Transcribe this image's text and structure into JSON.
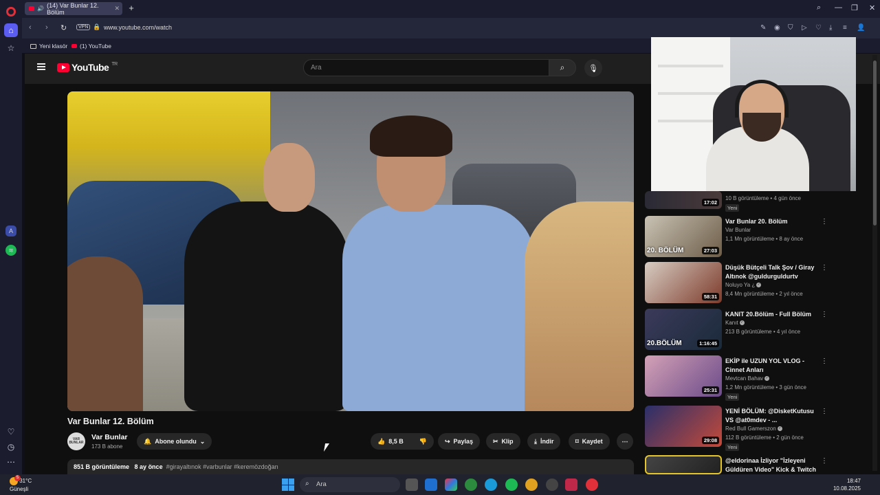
{
  "browser": {
    "tab_title": "(14) Var Bunlar 12. Bölüm",
    "url": "www.youtube.com/watch",
    "vpn_label": "VPN",
    "bookmarks": [
      "Yeni klasör",
      "(1) YouTube"
    ]
  },
  "youtube": {
    "logo_text": "YouTube",
    "logo_region": "TR",
    "search_placeholder": "Ara",
    "video": {
      "title": "Var Bunlar 12. Bölüm",
      "channel": "Var Bunlar",
      "channel_avatar_text": "VAR BUNLAR",
      "subscribers": "173 B abone",
      "subscribe_label": "Abone olundu",
      "likes": "8,5 B",
      "share_label": "Paylaş",
      "clip_label": "Klip",
      "download_label": "İndir",
      "save_label": "Kaydet",
      "views": "851 B görüntüleme",
      "age": "8 ay önce",
      "tags": "#girayaltınok #varbunlar #keremözdoğan"
    },
    "recommendations": [
      {
        "title": "",
        "channel": "",
        "meta": "10 B görüntüleme • 4 gün önce",
        "duration": "17:02",
        "badge": "Yeni",
        "thumb_tag": ""
      },
      {
        "title": "Var Bunlar 20. Bölüm",
        "channel": "Var Bunlar",
        "meta": "1,1 Mn görüntüleme • 8 ay önce",
        "duration": "27:03",
        "badge": "",
        "thumb_tag": "20. BÖLÜM"
      },
      {
        "title": "Düşük Bütçeli Talk Şov / Giray Altınok @guldurguldurtv",
        "channel": "Noluyo Ya ¿",
        "meta": "8,4 Mn görüntüleme • 2 yıl önce",
        "duration": "58:31",
        "badge": "",
        "thumb_tag": ""
      },
      {
        "title": "KANIT 20.Bölüm - Full Bölüm",
        "channel": "Kanıt",
        "meta": "213 B görüntüleme • 4 yıl önce",
        "duration": "1:16:45",
        "badge": "",
        "thumb_tag": "20.BÖLÜM"
      },
      {
        "title": "EKİP ile UZUN YOL VLOG - Cinnet Anları",
        "channel": "Mevtcan Bahav",
        "meta": "1,2 Mn görüntüleme • 3 gün önce",
        "duration": "25:31",
        "badge": "Yeni",
        "thumb_tag": ""
      },
      {
        "title": "YENİ BÖLÜM: @DisketKutusu VS @at0mdev - ...",
        "channel": "Red Bull Gamerszon",
        "meta": "112 B görüntüleme • 2 gün önce",
        "duration": "29:08",
        "badge": "Yeni",
        "thumb_tag": ""
      },
      {
        "title": "@eldorinaa İzliyor \"İzleyeni Güldüren Video\" Kick & Twitch ...",
        "channel": "",
        "meta": "",
        "duration": "",
        "badge": "",
        "thumb_tag": ""
      }
    ]
  },
  "taskbar": {
    "temperature": "31°C",
    "weather": "Güneşli",
    "weather_badge": "5",
    "search_label": "Ara",
    "time": "18:47",
    "date": "10.08.2025"
  },
  "colors": {
    "accent": "#5b5cf0",
    "youtube_red": "#ff0033",
    "page_bg": "#0f0f0f"
  }
}
